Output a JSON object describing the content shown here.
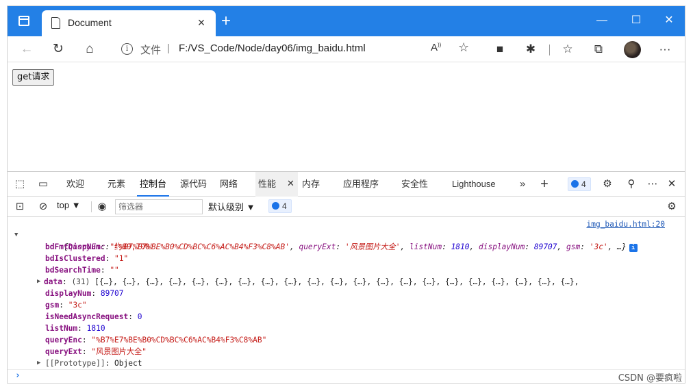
{
  "browser": {
    "tab_title": "Document",
    "tab_close": "×",
    "new_tab": "+",
    "window_controls": {
      "minimize": "—",
      "maximize": "☐",
      "close": "✕"
    },
    "address": {
      "info_label": "文件",
      "separator": "|",
      "url": "F:/VS_Code/Node/day06/img_baidu.html"
    },
    "icons": [
      "back-icon",
      "refresh-icon",
      "home-icon",
      "info-icon",
      "read-aloud-icon",
      "add-favorite-icon",
      "extension-icon",
      "puzzle-icon",
      "favorites-icon",
      "collections-icon",
      "avatar",
      "more-icon"
    ]
  },
  "page": {
    "get_button": "get请求"
  },
  "devtools": {
    "tabs": [
      "欢迎",
      "元素",
      "控制台",
      "源代码",
      "网络",
      "性能",
      "内存",
      "应用程序",
      "安全性",
      "Lighthouse"
    ],
    "active_tab": "控制台",
    "issues_count": "4",
    "toolbar": {
      "context": "top",
      "filter_placeholder": "筛选器",
      "level": "默认级别",
      "issues_count": "4"
    },
    "console": {
      "source_link": "img_baidu.html:20",
      "summary": {
        "open": "{",
        "k1": "queryEnc",
        "v1": "'%B7%E7%BE%B0%CD%BC%C6%AC%B4%F3%C8%AB'",
        "k2": "queryExt",
        "v2": "'风景图片大全'",
        "k3": "listNum",
        "v3": "1810",
        "k4": "displayNum",
        "v4": "89707",
        "k5": "gsm",
        "v5": "'3c'",
        "tail": "…}",
        "info": "i"
      },
      "props": [
        {
          "key": "bdFmtDispNum",
          "value": "\"约89,700\"",
          "type": "str"
        },
        {
          "key": "bdIsClustered",
          "value": "\"1\"",
          "type": "str"
        },
        {
          "key": "bdSearchTime",
          "value": "\"\"",
          "type": "str"
        }
      ],
      "data_row": {
        "key": "data",
        "count": "(31)",
        "preview": "[{…}, {…}, {…}, {…}, {…}, {…}, {…}, {…}, {…}, {…}, {…}, {…}, {…}, {…}, {…}, {…}, {…}, {…}, {…}, {…}, {…},"
      },
      "props2": [
        {
          "key": "displayNum",
          "value": "89707",
          "type": "num"
        },
        {
          "key": "gsm",
          "value": "\"3c\"",
          "type": "str"
        },
        {
          "key": "isNeedAsyncRequest",
          "value": "0",
          "type": "num"
        },
        {
          "key": "listNum",
          "value": "1810",
          "type": "num"
        },
        {
          "key": "queryEnc",
          "value": "\"%B7%E7%BE%B0%CD%BC%C6%AC%B4%F3%C8%AB\"",
          "type": "str"
        },
        {
          "key": "queryExt",
          "value": "\"风景图片大全\"",
          "type": "str"
        }
      ],
      "prototype": {
        "key": "[[Prototype]]",
        "value": "Object"
      },
      "prompt": "›"
    }
  },
  "watermark": "CSDN @要疯啦"
}
